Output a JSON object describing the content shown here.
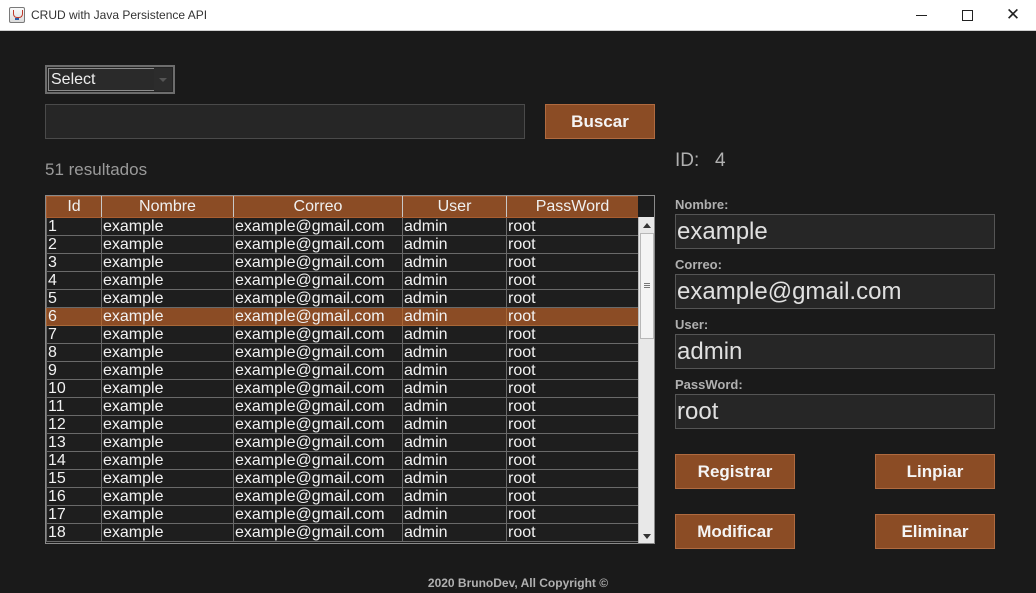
{
  "window": {
    "title": "CRUD with Java Persistence API"
  },
  "search": {
    "select_value": "Select",
    "query_value": "",
    "button_label": "Buscar",
    "results_text": "51 resultados"
  },
  "table": {
    "columns": [
      "Id",
      "Nombre",
      "Correo",
      "User",
      "PassWord"
    ],
    "selected_id": "6",
    "rows": [
      [
        "1",
        "example",
        "example@gmail.com",
        "admin",
        "root"
      ],
      [
        "2",
        "example",
        "example@gmail.com",
        "admin",
        "root"
      ],
      [
        "3",
        "example",
        "example@gmail.com",
        "admin",
        "root"
      ],
      [
        "4",
        "example",
        "example@gmail.com",
        "admin",
        "root"
      ],
      [
        "5",
        "example",
        "example@gmail.com",
        "admin",
        "root"
      ],
      [
        "6",
        "example",
        "example@gmail.com",
        "admin",
        "root"
      ],
      [
        "7",
        "example",
        "example@gmail.com",
        "admin",
        "root"
      ],
      [
        "8",
        "example",
        "example@gmail.com",
        "admin",
        "root"
      ],
      [
        "9",
        "example",
        "example@gmail.com",
        "admin",
        "root"
      ],
      [
        "10",
        "example",
        "example@gmail.com",
        "admin",
        "root"
      ],
      [
        "11",
        "example",
        "example@gmail.com",
        "admin",
        "root"
      ],
      [
        "12",
        "example",
        "example@gmail.com",
        "admin",
        "root"
      ],
      [
        "13",
        "example",
        "example@gmail.com",
        "admin",
        "root"
      ],
      [
        "14",
        "example",
        "example@gmail.com",
        "admin",
        "root"
      ],
      [
        "15",
        "example",
        "example@gmail.com",
        "admin",
        "root"
      ],
      [
        "16",
        "example",
        "example@gmail.com",
        "admin",
        "root"
      ],
      [
        "17",
        "example",
        "example@gmail.com",
        "admin",
        "root"
      ],
      [
        "18",
        "example",
        "example@gmail.com",
        "admin",
        "root"
      ]
    ]
  },
  "form": {
    "id_label": "ID:",
    "id_value": "4",
    "nombre_label": "Nombre:",
    "nombre_value": "example",
    "correo_label": "Correo:",
    "correo_value": "example@gmail.com",
    "user_label": "User:",
    "user_value": "admin",
    "password_label": "PassWord:",
    "password_value": "root"
  },
  "actions": {
    "registrar": "Registrar",
    "limpiar": "Linpiar",
    "modificar": "Modificar",
    "eliminar": "Eliminar"
  },
  "footer": {
    "text": "2020 BrunoDev, All Copyright ©"
  },
  "colors": {
    "accent": "#8b4c25",
    "background": "#1a1a1a",
    "text_muted": "#b0b0b0"
  }
}
